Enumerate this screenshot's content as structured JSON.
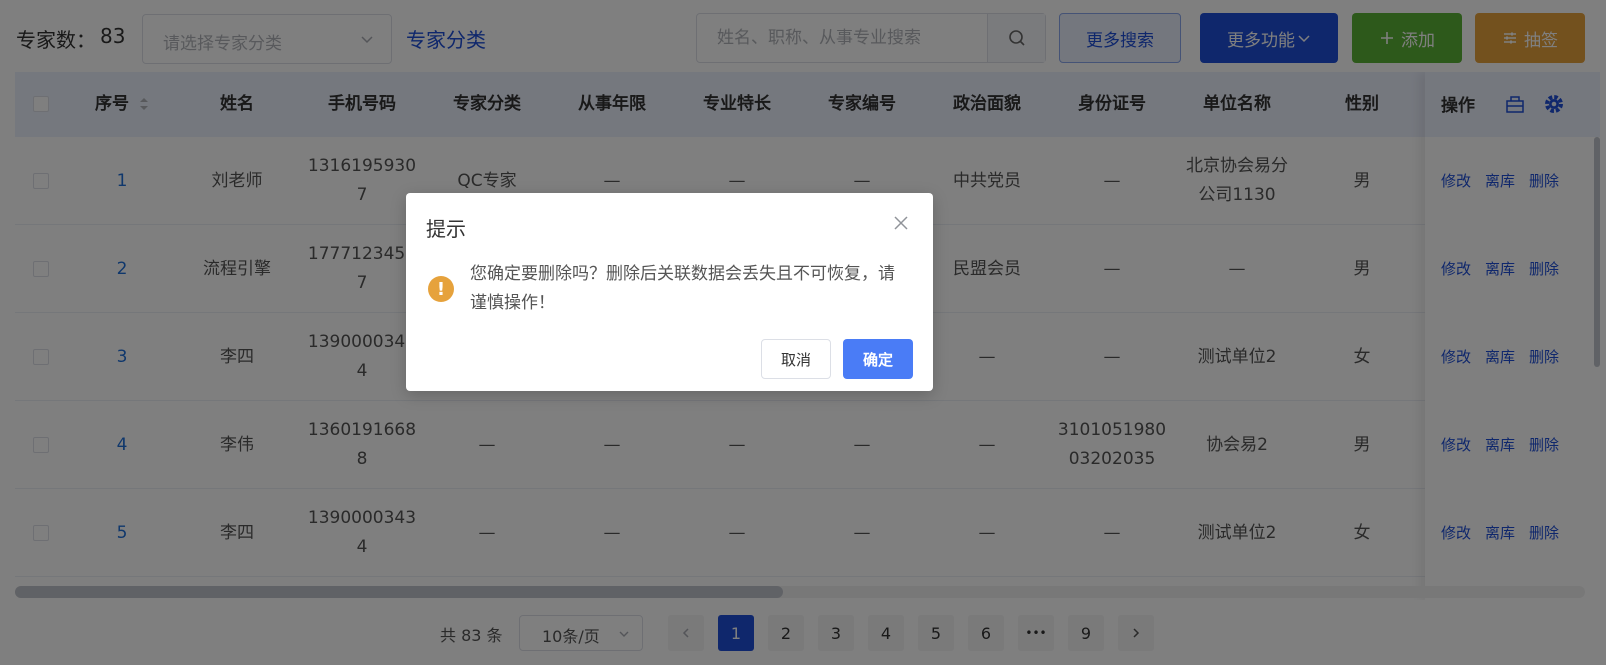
{
  "toolbar": {
    "count_label": "专家数：",
    "count_value": "83",
    "category_placeholder": "请选择专家分类",
    "category_link": "专家分类",
    "search_placeholder": "姓名、职称、从事专业搜索",
    "more_search": "更多搜索",
    "more_functions": "更多功能",
    "add": "添加",
    "draw": "抽签"
  },
  "table": {
    "headers": [
      "序号",
      "姓名",
      "手机号码",
      "专家分类",
      "从事年限",
      "专业特长",
      "专家编号",
      "政治面貌",
      "身份证号",
      "单位名称",
      "性别"
    ],
    "operation_header": "操作",
    "rows": [
      {
        "idx": "1",
        "name": "刘老师",
        "phone": "13161959307",
        "category": "QC专家",
        "years": "—",
        "specialty": "—",
        "code": "—",
        "political": "中共党员",
        "id_no": "—",
        "unit": "北京协会易分公司1130",
        "gender": "男"
      },
      {
        "idx": "2",
        "name": "流程引擎",
        "phone": "17771234567",
        "category": "",
        "years": "",
        "specialty": "",
        "code": "",
        "political": "民盟会员",
        "id_no": "—",
        "unit": "—",
        "gender": "男"
      },
      {
        "idx": "3",
        "name": "李四",
        "phone": "13900003434",
        "category": "",
        "years": "",
        "specialty": "",
        "code": "",
        "political": "—",
        "id_no": "—",
        "unit": "测试单位2",
        "gender": "女"
      },
      {
        "idx": "4",
        "name": "李伟",
        "phone": "13601916688",
        "category": "—",
        "years": "—",
        "specialty": "—",
        "code": "—",
        "political": "—",
        "id_no": "310105198003202035",
        "unit": "协会易2",
        "gender": "男"
      },
      {
        "idx": "5",
        "name": "李四",
        "phone": "13900003434",
        "category": "—",
        "years": "—",
        "specialty": "—",
        "code": "—",
        "political": "—",
        "id_no": "—",
        "unit": "测试单位2",
        "gender": "女"
      }
    ],
    "ops": {
      "edit": "修改",
      "leave": "离库",
      "delete": "删除"
    }
  },
  "pagination": {
    "total": "共 83 条",
    "page_size": "10条/页",
    "pages": [
      "1",
      "2",
      "3",
      "4",
      "5",
      "6",
      "•••",
      "9"
    ],
    "current": "1"
  },
  "dialog": {
    "title": "提示",
    "message": "您确定要删除吗？删除后关联数据会丢失且不可恢复，请谨慎操作！",
    "cancel": "取消",
    "confirm": "确定"
  },
  "colors": {
    "primary": "#1f4fd8",
    "success": "#5bb236",
    "warning": "#e6a23c",
    "confirm": "#4a7cf6"
  }
}
